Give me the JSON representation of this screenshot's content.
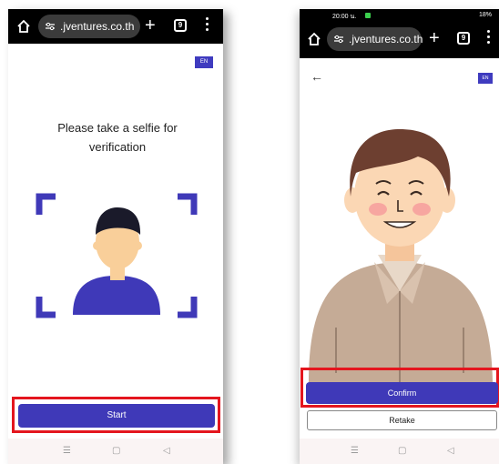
{
  "left_phone": {
    "url": ".jventures.co.th",
    "tab_count": "9",
    "language_button": "EN",
    "instruction": "Please take a selfie for verification",
    "start_button": "Start"
  },
  "right_phone": {
    "status_time": "20:00 น.",
    "status_right": "18%",
    "url": ".jventures.co.th",
    "tab_count": "9",
    "language_button": "EN",
    "confirm_button": "Confirm",
    "retake_button": "Retake"
  },
  "nav_icons": [
    "menu-icon",
    "home-circle-icon",
    "back-triangle-icon"
  ],
  "colors": {
    "accent": "#3f39b8",
    "highlight": "#e4161e"
  }
}
